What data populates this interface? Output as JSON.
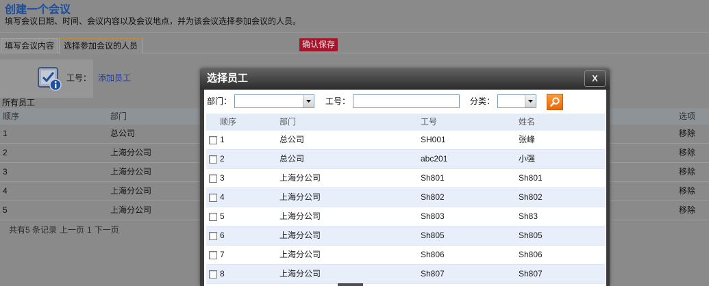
{
  "page": {
    "title": "创建一个会议",
    "subtitle": "填写会议日期、时间、会议内容以及会议地点，并为该会议选择参加会议的人员。"
  },
  "tabs": [
    {
      "label": "填写会议内容",
      "active": false
    },
    {
      "label": "选择参加会议的人员",
      "active": true
    }
  ],
  "save_button": {
    "label": "确认保存"
  },
  "employee_panel": {
    "icon": "clipboard-check-info-icon",
    "id_label": "工号：",
    "add_link": "添加员工"
  },
  "all_employees": {
    "title": "所有员工",
    "columns": {
      "order": "顺序",
      "department": "部门",
      "options": "选项"
    },
    "rows": [
      {
        "order": "1",
        "department": "总公司",
        "action": "移除"
      },
      {
        "order": "2",
        "department": "上海分公司",
        "action": "移除"
      },
      {
        "order": "3",
        "department": "上海分公司",
        "action": "移除"
      },
      {
        "order": "4",
        "department": "上海分公司",
        "action": "移除"
      },
      {
        "order": "5",
        "department": "上海分公司",
        "action": "移除"
      }
    ],
    "pager": {
      "summary": "共有5 条记录",
      "prev": "上一页",
      "page": "1",
      "next": "下一页"
    }
  },
  "dialog": {
    "title": "选择员工",
    "close_label": "X",
    "filters": {
      "department_label": "部门：",
      "department_value": "",
      "employee_id_label": "工号：",
      "employee_id_value": "",
      "category_label": "分类：",
      "category_value": "",
      "search_icon": "search-icon"
    },
    "columns": {
      "order": "顺序",
      "department": "部门",
      "employee_id": "工号",
      "name": "姓名"
    },
    "rows": [
      {
        "checked": false,
        "order": "1",
        "department": "总公司",
        "employee_id": "SH001",
        "name": "张峰"
      },
      {
        "checked": false,
        "order": "2",
        "department": "总公司",
        "employee_id": "abc201",
        "name": "小强"
      },
      {
        "checked": false,
        "order": "3",
        "department": "上海分公司",
        "employee_id": "Sh801",
        "name": "Sh801"
      },
      {
        "checked": false,
        "order": "4",
        "department": "上海分公司",
        "employee_id": "Sh802",
        "name": "Sh802"
      },
      {
        "checked": false,
        "order": "5",
        "department": "上海分公司",
        "employee_id": "Sh803",
        "name": "Sh83"
      },
      {
        "checked": false,
        "order": "6",
        "department": "上海分公司",
        "employee_id": "Sh805",
        "name": "Sh805"
      },
      {
        "checked": false,
        "order": "7",
        "department": "上海分公司",
        "employee_id": "Sh806",
        "name": "Sh806"
      },
      {
        "checked": false,
        "order": "8",
        "department": "上海分公司",
        "employee_id": "Sh807",
        "name": "Sh807"
      }
    ]
  },
  "colors": {
    "page_title": "#1b4d9c",
    "save_button": "#a3162c",
    "dialog_titlebar": "#3b3b3b",
    "search_button": "#f07a14",
    "dialog_table_header": "#e3ecf7",
    "dialog_row_alt": "#e8eefa"
  }
}
